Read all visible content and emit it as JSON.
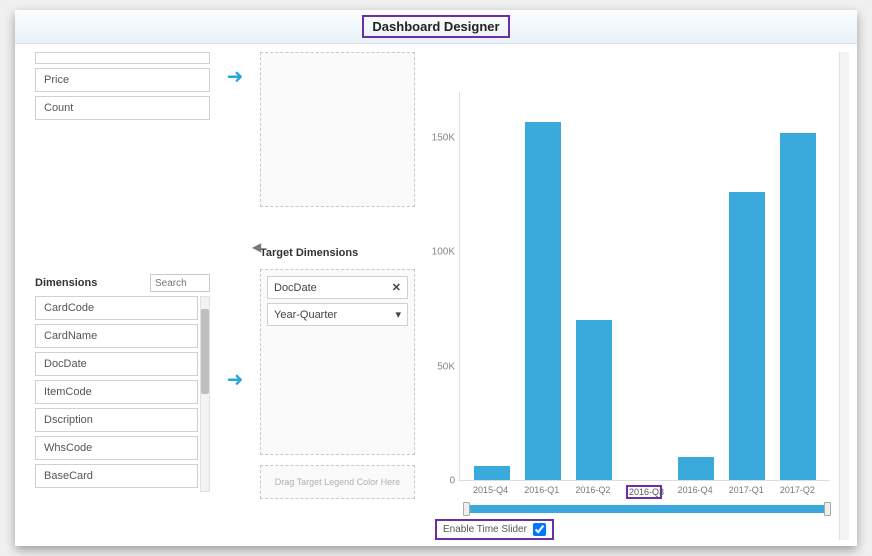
{
  "title": "Dashboard Designer",
  "measures": {
    "items": [
      "",
      "Price",
      "Count"
    ]
  },
  "dimensions": {
    "label": "Dimensions",
    "search_placeholder": "Search",
    "items": [
      "CardCode",
      "CardName",
      "DocDate",
      "ItemCode",
      "Dscription",
      "WhsCode",
      "BaseCard"
    ]
  },
  "target": {
    "dimensions_label": "Target Dimensions",
    "selected_field": "DocDate",
    "granularity": "Year-Quarter",
    "legend_drop_text": "Drag Target Legend Color Here"
  },
  "time_slider": {
    "label": "Enable Time Slider",
    "checked": true
  },
  "chart_data": {
    "type": "bar",
    "categories": [
      "2015-Q4",
      "2016-Q1",
      "2016-Q2",
      "2016-Q3",
      "2016-Q4",
      "2017-Q1",
      "2017-Q2"
    ],
    "values": [
      6000,
      157000,
      70000,
      0,
      10000,
      126000,
      152000
    ],
    "ylim": [
      0,
      170000
    ],
    "y_ticks": [
      0,
      50000,
      100000,
      150000
    ],
    "y_tick_labels": [
      "0",
      "50K",
      "100K",
      "150K"
    ],
    "title": "",
    "xlabel": "",
    "ylabel": ""
  }
}
